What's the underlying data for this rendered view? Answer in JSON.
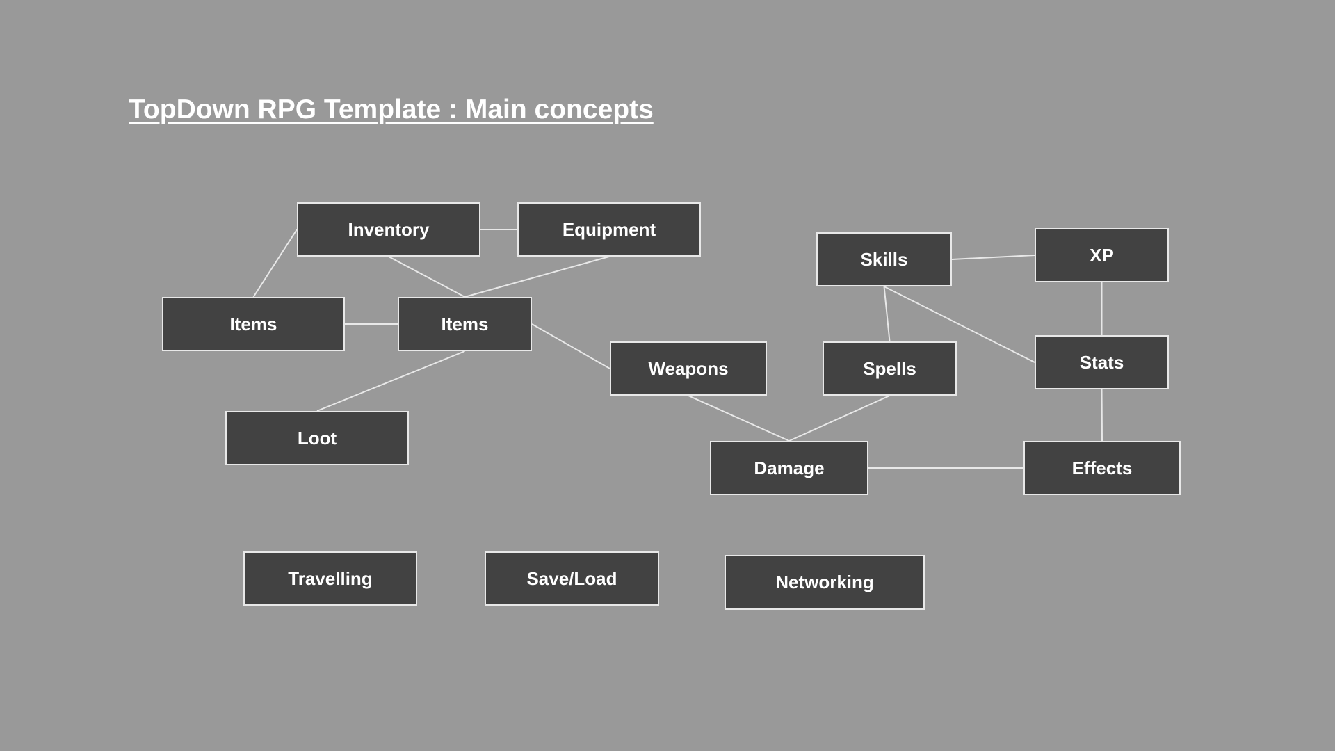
{
  "title": "TopDown RPG Template : Main concepts",
  "colors": {
    "background": "#999999",
    "node_fill": "#424242",
    "node_border": "#e8e8e8",
    "connector": "#e8e8e8",
    "text": "#ffffff"
  },
  "nodes": {
    "inventory": "Inventory",
    "equipment": "Equipment",
    "items_left": "Items",
    "items_center": "Items",
    "weapons": "Weapons",
    "loot": "Loot",
    "skills": "Skills",
    "xp": "XP",
    "spells": "Spells",
    "stats": "Stats",
    "damage": "Damage",
    "effects": "Effects",
    "travelling": "Travelling",
    "saveload": "Save/Load",
    "networking": "Networking"
  },
  "edges": [
    [
      "inventory",
      "equipment"
    ],
    [
      "items_left",
      "inventory"
    ],
    [
      "inventory",
      "items_center"
    ],
    [
      "equipment",
      "items_center"
    ],
    [
      "items_left",
      "items_center"
    ],
    [
      "items_center",
      "weapons"
    ],
    [
      "items_center",
      "loot"
    ],
    [
      "weapons",
      "damage"
    ],
    [
      "spells",
      "damage"
    ],
    [
      "damage",
      "effects"
    ],
    [
      "skills",
      "xp"
    ],
    [
      "skills",
      "spells"
    ],
    [
      "skills",
      "stats"
    ],
    [
      "xp",
      "stats"
    ],
    [
      "stats",
      "effects"
    ]
  ]
}
